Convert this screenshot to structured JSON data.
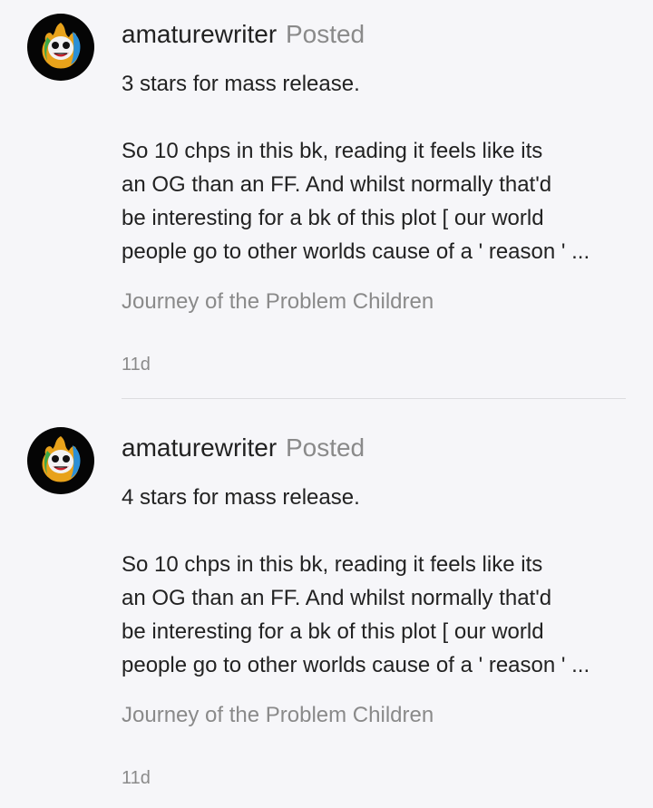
{
  "posts": [
    {
      "username": "amaturewriter",
      "action": "Posted",
      "rating_text": "3 stars for mass release.",
      "body_lines": [
        "So 10 chps in this bk, reading it feels like its",
        "an OG than an FF. And whilst normally that'd",
        "be interesting for a bk of this plot [ our world",
        "people go to other worlds cause of a ' reason ' ..."
      ],
      "book_title": "Journey of the Problem Children",
      "timestamp": "11d",
      "avatar_icon": "fire-skull-avatar-icon"
    },
    {
      "username": "amaturewriter",
      "action": "Posted",
      "rating_text": "4 stars for mass release.",
      "body_lines": [
        "So 10 chps in this bk, reading it feels like its",
        "an OG than an FF. And whilst normally that'd",
        "be interesting for a bk of this plot [ our world",
        "people go to other worlds cause of a ' reason ' ..."
      ],
      "book_title": "Journey of the Problem Children",
      "timestamp": "11d",
      "avatar_icon": "fire-skull-avatar-icon"
    }
  ],
  "colors": {
    "background": "#f6f6f9",
    "primary_text": "#222222",
    "secondary_text": "#8a8a8a",
    "divider": "#dcdcdf"
  }
}
